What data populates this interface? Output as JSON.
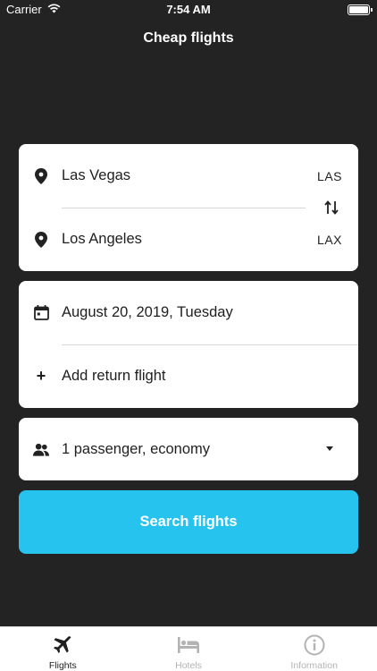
{
  "status": {
    "carrier": "Carrier",
    "time": "7:54 AM"
  },
  "nav": {
    "title": "Cheap flights"
  },
  "route": {
    "from": {
      "city": "Las Vegas",
      "code": "LAS"
    },
    "to": {
      "city": "Los Angeles",
      "code": "LAX"
    }
  },
  "dates": {
    "departure": "August 20, 2019, Tuesday",
    "return_label": "Add return flight",
    "add_symbol": "+"
  },
  "passengers": {
    "summary": "1 passenger, economy"
  },
  "search": {
    "label": "Search flights"
  },
  "tabs": [
    {
      "label": "Flights",
      "icon": "plane-icon",
      "active": true
    },
    {
      "label": "Hotels",
      "icon": "bed-icon",
      "active": false
    },
    {
      "label": "Information",
      "icon": "info-icon",
      "active": false
    }
  ],
  "colors": {
    "background": "#232323",
    "accent": "#26c3ee",
    "card": "#ffffff",
    "inactive_tab": "#b3b3b3"
  }
}
